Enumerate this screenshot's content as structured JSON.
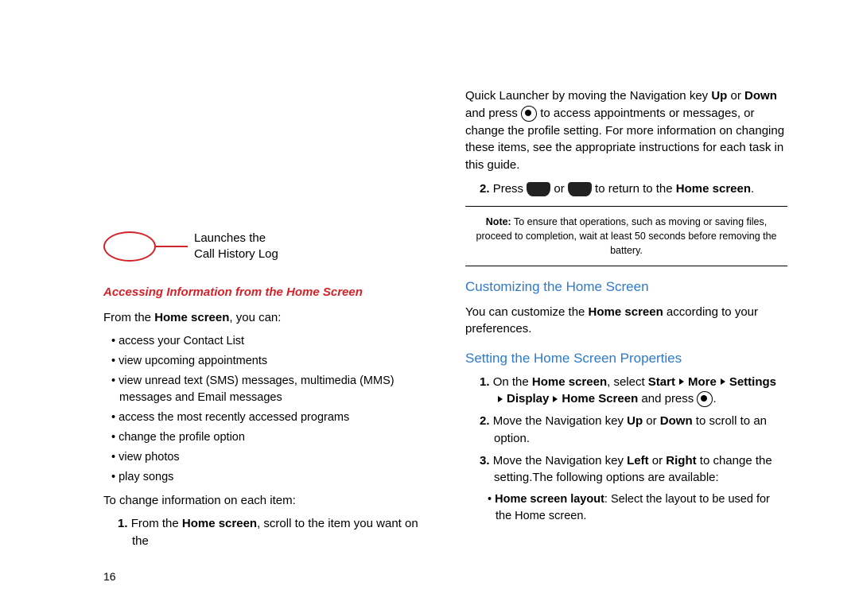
{
  "pageNumber": "16",
  "left": {
    "callout_line1": "Launches the",
    "callout_line2": "Call History Log",
    "subheading": "Accessing Information from the Home Screen",
    "intro_pre": "From the ",
    "intro_bold": "Home screen",
    "intro_post": ", you can:",
    "bullets": [
      "access your Contact List",
      "view upcoming appointments",
      "view unread text (SMS) messages, multimedia (MMS) messages and Email messages",
      "access the most recently accessed programs",
      "change the profile option",
      "view photos",
      "play songs"
    ],
    "changeline": "To change information on each item:",
    "step1_num": "1.",
    "step1_pre": "From the ",
    "step1_bold": "Home screen",
    "step1_post": ", scroll to the item you want on the"
  },
  "right": {
    "para1_pre": "Quick Launcher by moving the Navigation key ",
    "up": "Up",
    "or": " or ",
    "down": "Down",
    "para1_mid1": " and press ",
    "para1_mid2": " to access appointments or messages, or change the profile setting. For more information on changing these items, see the appropriate instructions for each task in this guide.",
    "step2_num": "2.",
    "step2_pre": "Press ",
    "step2_or": " or ",
    "step2_mid": " to return to the ",
    "step2_bold": "Home screen",
    "step2_end": ".",
    "note_bold": "Note:",
    "note_text": " To ensure that operations, such as moving or saving files, proceed to completion, wait at least 50 seconds before removing the battery.",
    "h1": "Customizing the Home Screen",
    "custom_pre": "You can customize the ",
    "custom_bold": "Home screen",
    "custom_post": " according to your preferences.",
    "h2": "Setting the Home Screen Properties",
    "sp1_num": "1.",
    "sp1_pre": "On the ",
    "sp1_bold1": "Home screen",
    "sp1_mid1": ", select ",
    "sp1_bold2": "Start",
    "sp1_bold3": "More",
    "sp1_bold4": "Settings",
    "sp1_bold5": "Display",
    "sp1_bold6": "Home Screen",
    "sp1_mid2": " and press ",
    "sp1_end": ".",
    "sp2_num": "2.",
    "sp2_pre": "Move the Navigation key ",
    "sp2_mid": " to scroll to an option.",
    "sp3_num": "3.",
    "sp3_pre": "Move the Navigation key ",
    "left_word": "Left",
    "right_word": "Right",
    "sp3_post": " to change the setting.The following options are available:",
    "optb": "Home screen layout",
    "opt_text": ": Select the layout to be used for the Home screen."
  }
}
